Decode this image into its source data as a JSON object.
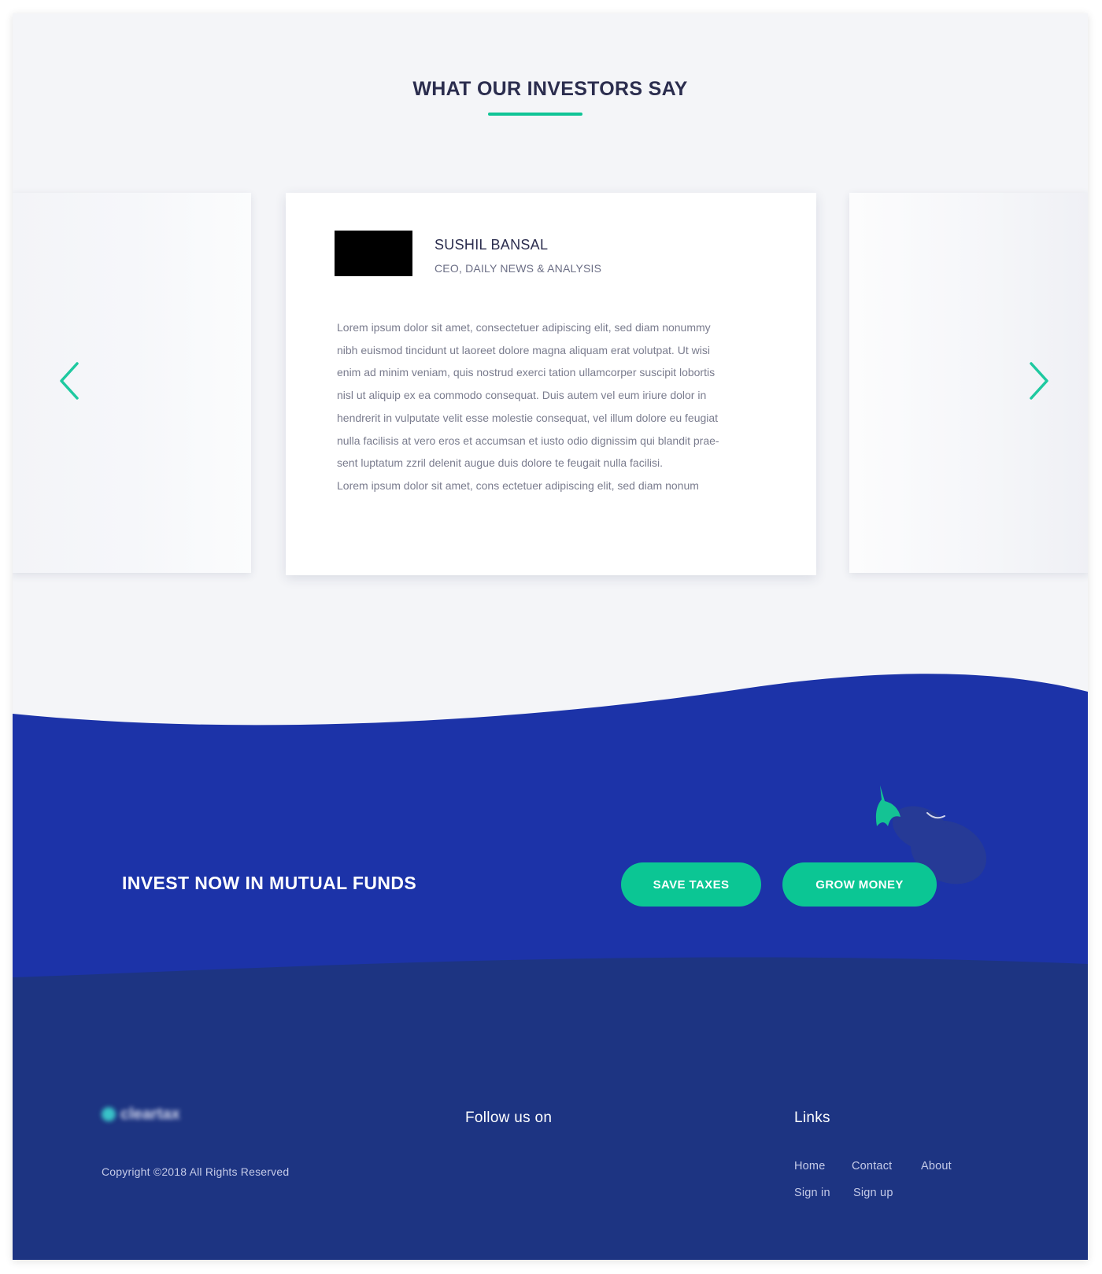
{
  "testimonials": {
    "title": "WHAT OUR INVESTORS SAY",
    "active": {
      "name": "SUSHIL BANSAL",
      "role": "CEO, DAILY NEWS & ANALYSIS",
      "quote": "Lorem ipsum dolor sit amet, consectetuer adipiscing elit, sed diam nonummy\nnibh euismod tincidunt ut laoreet dolore magna aliquam erat volutpat. Ut wisi\nenim ad minim veniam, quis nostrud exerci tation ullamcorper suscipit lobortis\nnisl ut aliquip ex ea commodo consequat. Duis autem vel eum iriure dolor in\nhendrerit in vulputate velit esse molestie consequat, vel illum dolore eu feugiat\nnulla facilisis at vero eros et accumsan et iusto odio dignissim qui blandit prae-\nsent luptatum zzril delenit augue duis dolore te feugait nulla facilisi.\nLorem ipsum dolor sit amet, cons ectetuer adipiscing elit, sed diam nonum"
    },
    "prev_icon": "chevron-left-icon",
    "next_icon": "chevron-right-icon"
  },
  "cta": {
    "heading": "INVEST NOW IN MUTUAL FUNDS",
    "save_label": "SAVE TAXES",
    "grow_label": "GROW MONEY",
    "illustration": "brinjal-icon"
  },
  "footer": {
    "logo_text": "cleartax",
    "copyright": "Copyright ©2018 All Rights Reserved",
    "follow_heading": "Follow us on",
    "links_heading": "Links",
    "links": [
      "Home",
      "Contact",
      "About",
      "Sign in",
      "Sign up"
    ]
  },
  "colors": {
    "accent": "#0fc496",
    "cta_blue": "#1c33a8",
    "footer_blue": "#1d3482",
    "heading_text": "#2b2d4e",
    "page_bg": "#f4f5f8"
  }
}
